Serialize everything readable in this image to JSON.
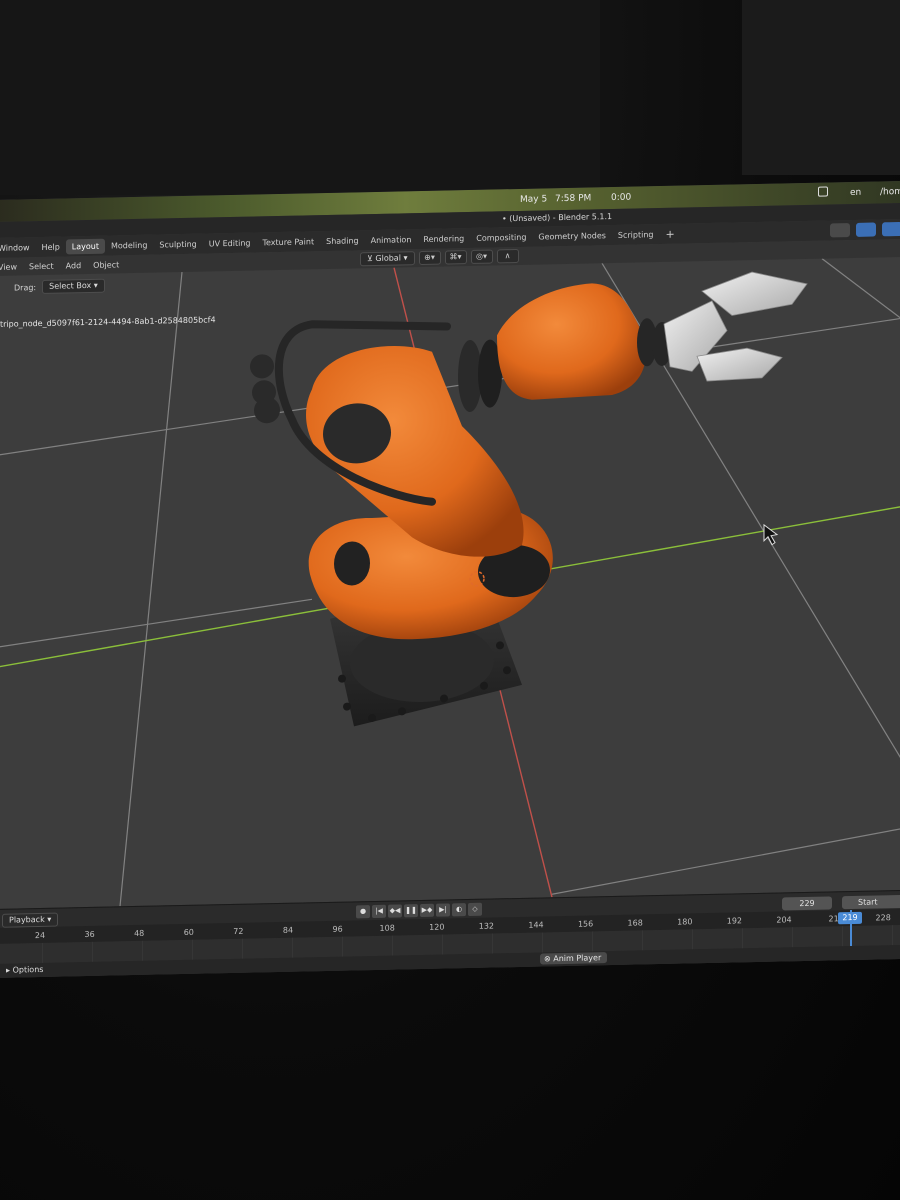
{
  "menubar": {
    "date": "May 5",
    "time": "7:58 PM",
    "timer": "0:00",
    "lang": "en",
    "user": "/hom"
  },
  "window": {
    "title": "• (Unsaved) - Blender 5.1.1"
  },
  "menus": [
    "Window",
    "Help"
  ],
  "workspace_tabs": [
    {
      "label": "Layout",
      "active": true
    },
    {
      "label": "Modeling"
    },
    {
      "label": "Sculpting"
    },
    {
      "label": "UV Editing"
    },
    {
      "label": "Texture Paint"
    },
    {
      "label": "Shading"
    },
    {
      "label": "Animation"
    },
    {
      "label": "Rendering"
    },
    {
      "label": "Compositing"
    },
    {
      "label": "Geometry Nodes"
    },
    {
      "label": "Scripting"
    }
  ],
  "viewport_menu": [
    "View",
    "Select",
    "Add",
    "Object"
  ],
  "header": {
    "orientation": "Global"
  },
  "tool_settings": {
    "drag_label": "Drag:",
    "drag_value": "Select Box"
  },
  "object_name": "tripo_node_d5097f61-2124-4494-8ab1-d2584805bcf4",
  "timeline": {
    "mode": "Playback",
    "current_frame": "229",
    "start_label": "Start",
    "playhead_frame": "219",
    "ticks": [
      "24",
      "36",
      "48",
      "60",
      "72",
      "84",
      "96",
      "108",
      "120",
      "132",
      "144",
      "156",
      "168",
      "180",
      "192",
      "204",
      "21",
      "228"
    ]
  },
  "statusbar": {
    "options": "Options",
    "anim_player": "Anim Player"
  },
  "colors": {
    "robot": "#e0691c",
    "robot_dark": "#2b2b2b",
    "gripper": "#cfcfcf",
    "x_axis": "#c0504a",
    "y_axis": "#8bbf3a",
    "accent": "#4a8bd6"
  }
}
